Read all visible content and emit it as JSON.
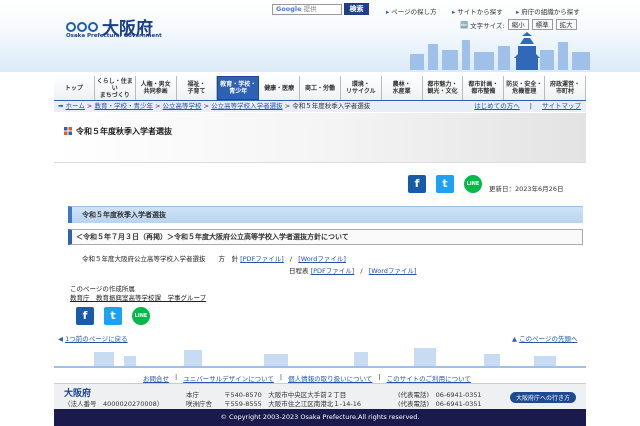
{
  "header": {
    "logo_ja": "大阪府",
    "logo_en": "Osaka Prefectural Government",
    "search_logo": "Google",
    "search_placeholder": "提供",
    "search_button": "検索",
    "link_find_page": "ページの探し方",
    "link_from_site": "サイトから探す",
    "link_org": "府庁の組織から探す",
    "font_size_label": "文字サイズ:",
    "font_small": "縮小",
    "font_standard": "標準",
    "font_large": "拡大"
  },
  "nav": [
    {
      "label": "トップ",
      "active": false
    },
    {
      "label": "くらし・住まい\nまちづくり",
      "active": false
    },
    {
      "label": "人権・男女\n共同参画",
      "active": false
    },
    {
      "label": "福祉・\n子育て",
      "active": false
    },
    {
      "label": "教育・学校・\n青少年",
      "active": true
    },
    {
      "label": "健康・医療",
      "active": false
    },
    {
      "label": "商工・労働",
      "active": false
    },
    {
      "label": "環境・\nリサイクル",
      "active": false
    },
    {
      "label": "農林・\n水産業",
      "active": false
    },
    {
      "label": "都市魅力・\n観光・文化",
      "active": false
    },
    {
      "label": "都市計画・\n都市整備",
      "active": false
    },
    {
      "label": "防災・安全・\n危機管理",
      "active": false
    },
    {
      "label": "府政運営・\n市町村",
      "active": false
    }
  ],
  "breadcrumb": {
    "items": [
      "ホーム",
      "教育・学校・青少年",
      "公立高等学校",
      "公立高等学校入学者選抜",
      "令和５年度秋季入学者選抜"
    ],
    "first_time": "はじめての方へ",
    "sitemap": "サイトマップ"
  },
  "page": {
    "title": "令和５年度秋季入学者選抜",
    "updated": "更新日：2023年6月26日",
    "section_title": "令和５年度秋季入学者選抜",
    "subsection": "＜令和５年７月３日（再掲）＞令和５年度大阪府公立高等学校入学者選抜方針について",
    "row1_label": "令和５年度大阪府公立高等学校入学者選抜　　方　針",
    "row2_label": "日程表",
    "pdf_file": "[PDFファイル]",
    "word_file": "[Wordファイル]",
    "separator": "/",
    "author_label": "このページの作成所属",
    "author_org": "教育庁　教育振興室高等学校課　学事グループ",
    "back_link": "1つ前のページに戻る",
    "top_link": "このページの先頭へ"
  },
  "social": {
    "facebook": "f",
    "twitter": "t",
    "line": "LINE"
  },
  "footer": {
    "links": [
      "お問合せ",
      "ユニバーサルデザインについて",
      "個人情報の取り扱いについて",
      "このサイトのご利用について"
    ],
    "name": "大阪府",
    "corp_no": "（法人番号　4000020270008）",
    "office1": "本庁",
    "office2": "咲洲庁舎",
    "addr1": "〒540-8570　大阪市中央区大手前２丁目",
    "addr2": "〒559-8555　大阪市住之江区南港北１-14-16",
    "tel1": "(代表電話)　06-6941-0351",
    "tel2": "(代表電話)　06-6941-0351",
    "access_btn": "大阪府庁への行き方",
    "copyright": "© Copyright 2003-2023 Osaka Prefecture,All rights reserved."
  }
}
